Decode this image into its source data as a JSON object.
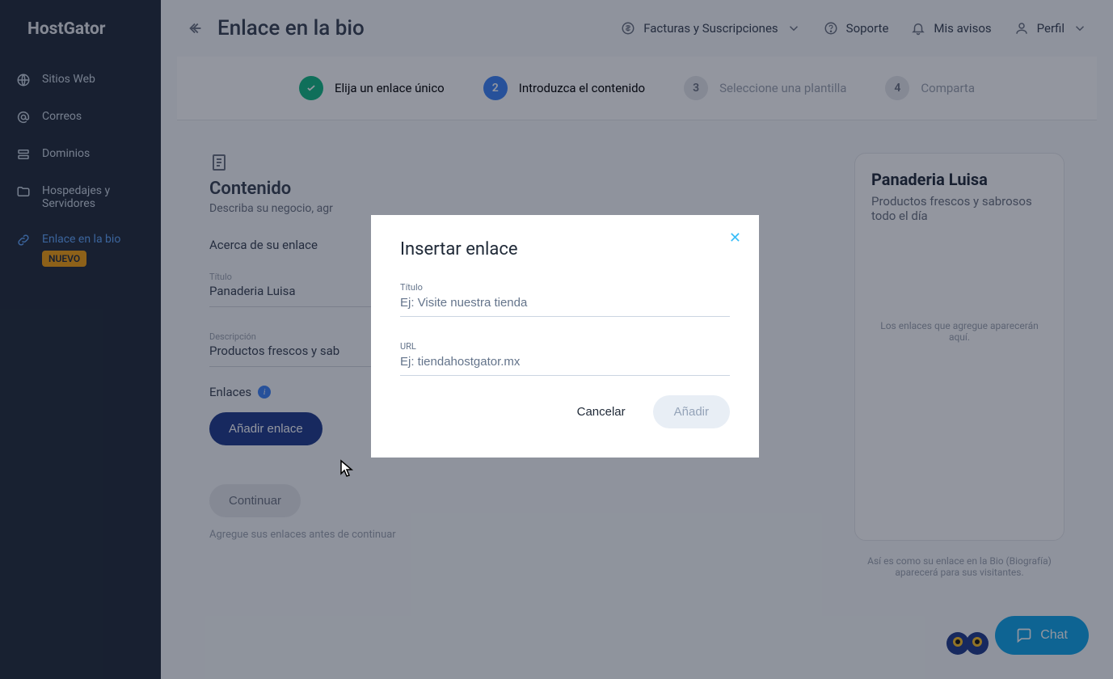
{
  "brand": "HostGator",
  "sidebar": {
    "items": [
      {
        "label": "Sitios Web"
      },
      {
        "label": "Correos"
      },
      {
        "label": "Dominios"
      },
      {
        "label": "Hospedajes y Servidores"
      },
      {
        "label": "Enlace en la bio",
        "badge": "NUEVO"
      }
    ]
  },
  "header": {
    "title": "Enlace en la bio",
    "actions": {
      "billing": "Facturas y Suscripciones",
      "support": "Soporte",
      "notices": "Mis avisos",
      "profile": "Perfil"
    }
  },
  "stepper": [
    {
      "num": "✓",
      "label": "Elija un enlace único",
      "state": "done"
    },
    {
      "num": "2",
      "label": "Introduzca el contenido",
      "state": "active"
    },
    {
      "num": "3",
      "label": "Seleccione una plantilla",
      "state": "pending"
    },
    {
      "num": "4",
      "label": "Comparta",
      "state": "pending"
    }
  ],
  "content": {
    "heading": "Contenido",
    "subheading": "Describa su negocio, agr",
    "about_section": "Acerca de su enlace",
    "form": {
      "title_label": "Título",
      "title_value": "Panaderia Luisa",
      "desc_label": "Descripción",
      "desc_value": "Productos frescos y sab"
    },
    "links_section": "Enlaces",
    "add_link_btn": "Añadir enlace",
    "continue_btn": "Continuar",
    "hint": "Agregue sus enlaces antes de continuar"
  },
  "preview": {
    "title": "Panaderia Luisa",
    "subtitle": "Productos frescos y sabrosos todo el día",
    "empty": "Los enlaces que agregue aparecerán aquí.",
    "caption": "Así es como su enlace en la Bio (Biografía) aparecerá para sus visitantes."
  },
  "modal": {
    "title": "Insertar enlace",
    "field1_label": "Título",
    "field1_placeholder": "Ej: Visite nuestra tienda",
    "field2_label": "URL",
    "field2_placeholder": "Ej: tiendahostgator.mx",
    "cancel": "Cancelar",
    "add": "Añadir"
  },
  "chat": "Chat"
}
